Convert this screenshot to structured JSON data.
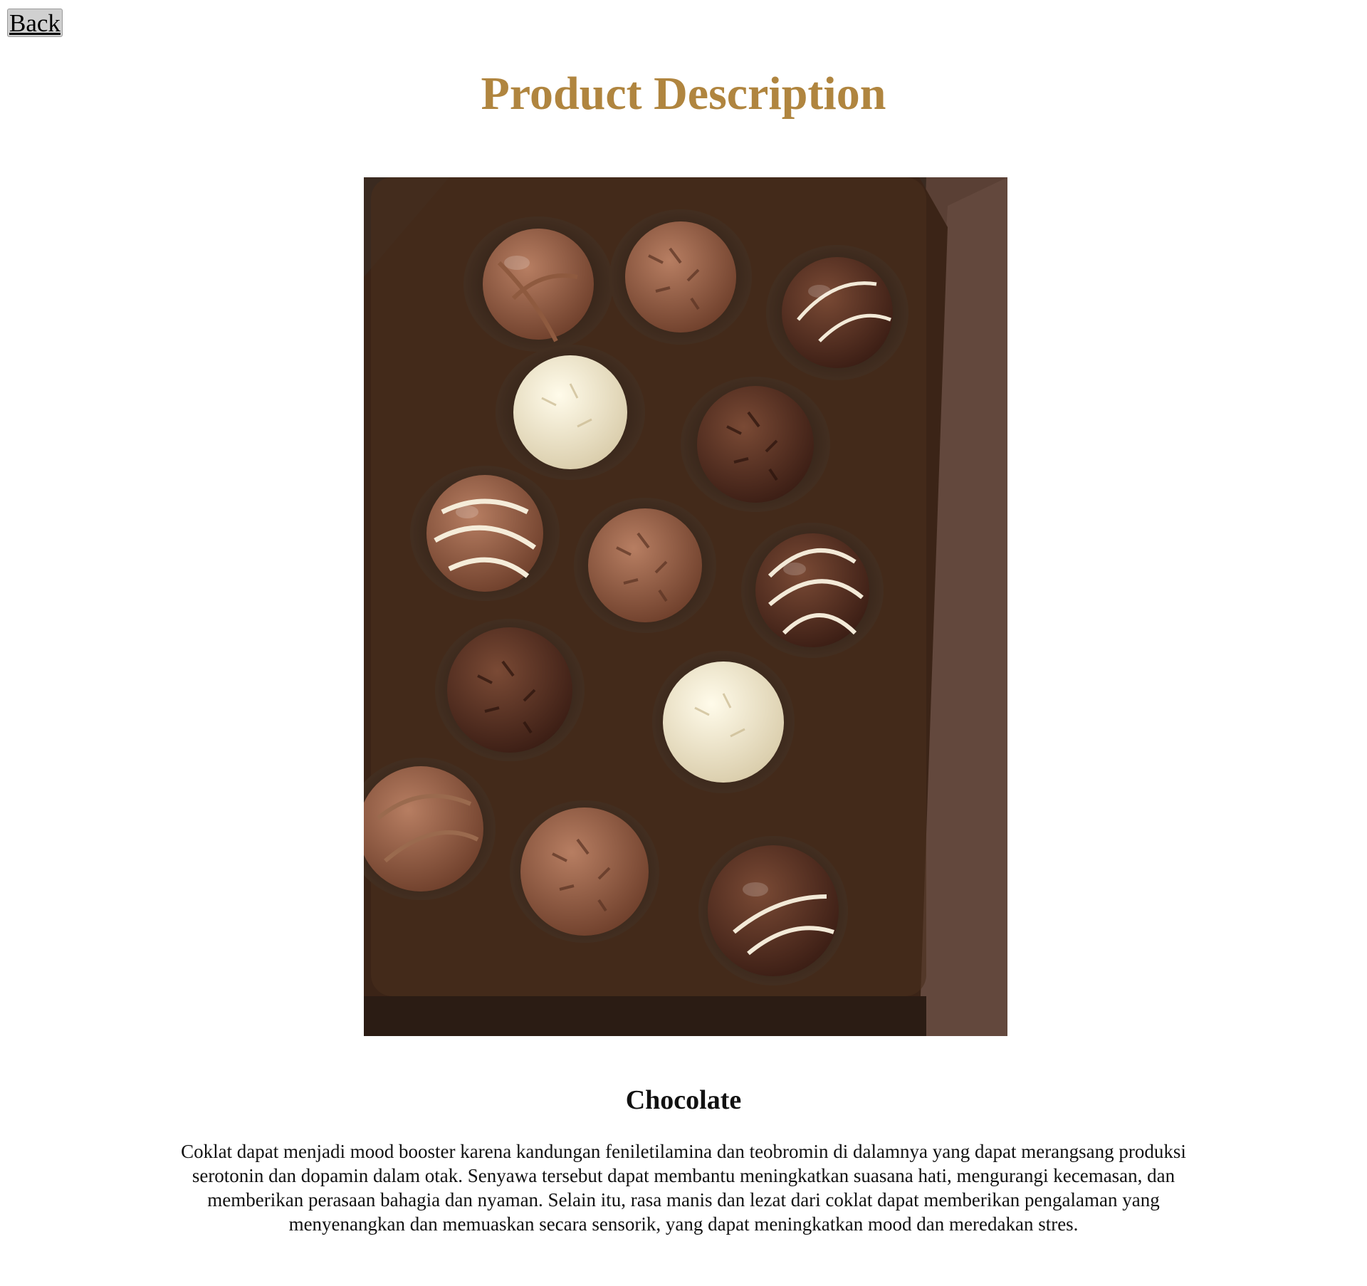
{
  "nav": {
    "back_label": "Back"
  },
  "header": {
    "title": "Product Description",
    "title_color": "#b0853f"
  },
  "product": {
    "image_alt": "box of chocolate truffles",
    "name": "Chocolate",
    "description": "Coklat dapat menjadi mood booster karena kandungan feniletilamina dan teobromin di dalamnya yang dapat merangsang produksi serotonin dan dopamin dalam otak. Senyawa tersebut dapat membantu meningkatkan suasana hati, mengurangi kecemasan, dan memberikan perasaan bahagia dan nyaman. Selain itu, rasa manis dan lezat dari coklat dapat memberikan pengalaman yang menyenangkan dan memuaskan secara sensorik, yang dapat meningkatkan mood dan meredakan stres."
  }
}
